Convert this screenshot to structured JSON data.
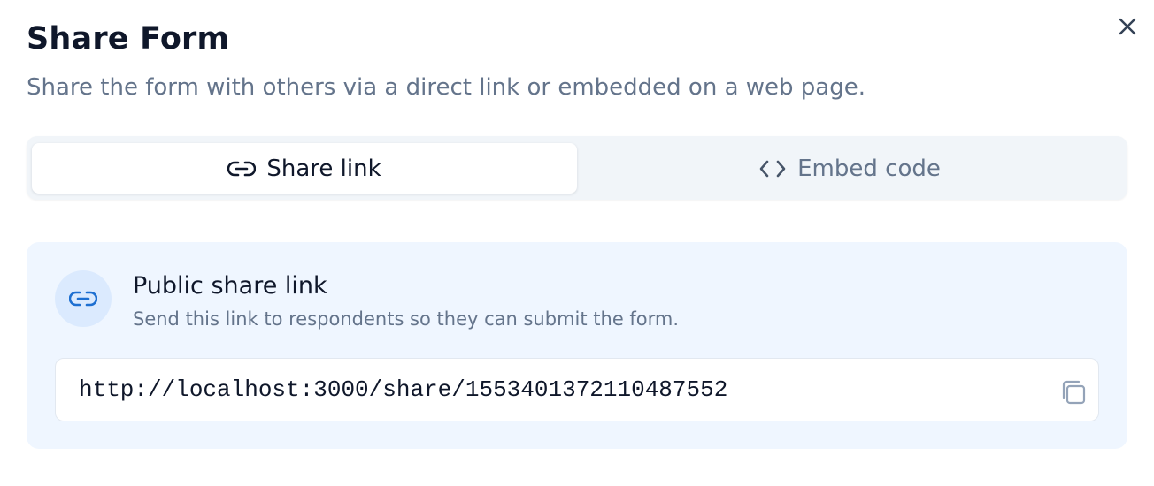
{
  "dialog": {
    "title": "Share Form",
    "subtitle": "Share the form with others via a direct link or embedded on a web page."
  },
  "tabs": [
    {
      "label": "Share link",
      "icon": "link-icon",
      "active": true
    },
    {
      "label": "Embed code",
      "icon": "code-icon",
      "active": false
    }
  ],
  "share_panel": {
    "icon": "link-icon",
    "title": "Public share link",
    "description": "Send this link to respondents so they can submit the form.",
    "url": "http://localhost:3000/share/1553401372110487552",
    "copy_icon": "copy-icon"
  },
  "colors": {
    "title": "#0f172a",
    "muted": "#64748b",
    "tabs_bg": "#f1f5f9",
    "panel_bg": "#eff6ff",
    "panel_icon_bg": "#dbeafe",
    "accent": "#1d6fd1"
  }
}
